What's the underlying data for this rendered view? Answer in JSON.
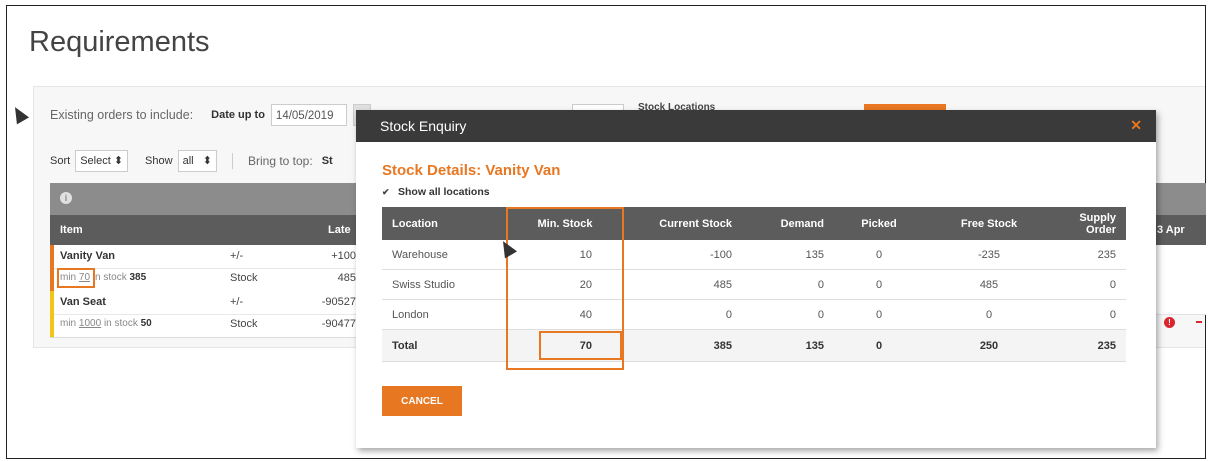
{
  "page": {
    "title": "Requirements"
  },
  "filters": {
    "existing_orders_label": "Existing orders to include:",
    "date_up_to_label": "Date up to",
    "date_value": "14/05/2019",
    "stock_locations_label": "Stock Locations",
    "sort_label": "Sort",
    "sort_value": "Select",
    "show_label": "Show",
    "show_value": "all",
    "bring_to_top_label": "Bring to top:",
    "bring_to_top_value": "St"
  },
  "grid": {
    "col_item": "Item",
    "col_late": "Late",
    "col_right": "3 Apr",
    "items": [
      {
        "name": "Vanity Van",
        "plus_minus": "+/-",
        "plus_minus_value": "+100",
        "min_label": "min",
        "min_value": "70",
        "in_stock_label": "in stock",
        "in_stock_value": "385",
        "stock_label": "Stock",
        "stock_value": "485",
        "bar_color": "#e87722"
      },
      {
        "name": "Van Seat",
        "plus_minus": "+/-",
        "plus_minus_value": "-90527",
        "min_label": "min",
        "min_value": "1000",
        "in_stock_label": "in stock",
        "in_stock_value": "50",
        "stock_label": "Stock",
        "stock_value": "-90477",
        "bar_color": "#f2c318"
      }
    ]
  },
  "modal": {
    "title": "Stock Enquiry",
    "details_title": "Stock Details: Vanity Van",
    "show_all_label": "Show all locations",
    "columns": [
      "Location",
      "Min. Stock",
      "Current Stock",
      "Demand",
      "Picked",
      "Free Stock",
      "Supply Order"
    ],
    "rows": [
      [
        "Warehouse",
        "10",
        "-100",
        "135",
        "0",
        "-235",
        "235"
      ],
      [
        "Swiss Studio",
        "20",
        "485",
        "0",
        "0",
        "485",
        "0"
      ],
      [
        "London",
        "40",
        "0",
        "0",
        "0",
        "0",
        "0"
      ]
    ],
    "total": [
      "Total",
      "70",
      "385",
      "135",
      "0",
      "250",
      "235"
    ],
    "cancel_label": "CANCEL"
  },
  "colors": {
    "accent": "#e87722",
    "header_dark": "#3a3a3a",
    "table_header": "#5c5c5c",
    "warning": "#d9262e"
  },
  "icons": {
    "info": "info-icon",
    "close": "close-icon",
    "warning": "warning-icon",
    "checkbox": "checkbox-checked-icon"
  }
}
